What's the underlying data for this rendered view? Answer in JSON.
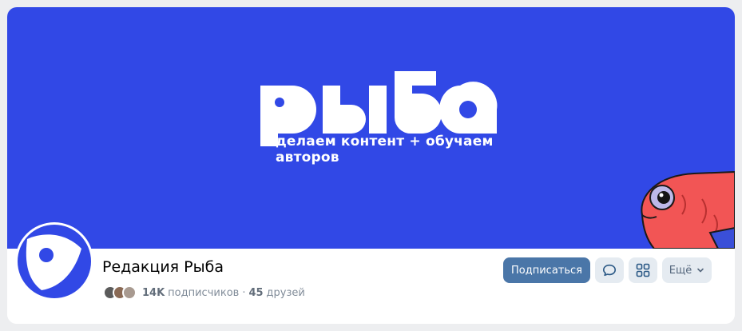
{
  "cover": {
    "logo_text": "рыба",
    "tagline": "делаем контент + обучаем авторов",
    "background_color": "#3148e6"
  },
  "profile": {
    "name": "Редакция Рыба",
    "subscribers_count": "14K",
    "subscribers_label": "подписчиков",
    "separator": "·",
    "friends_count": "45",
    "friends_label": "друзей"
  },
  "actions": {
    "subscribe_label": "Подписаться",
    "message_icon": "message-bubble-icon",
    "apps_icon": "apps-grid-icon",
    "more_label": "Ещё",
    "more_icon": "chevron-down-icon"
  },
  "colors": {
    "accent": "#4a76a8",
    "secondary_button": "#e5ebf1",
    "muted_text": "#818c99"
  }
}
